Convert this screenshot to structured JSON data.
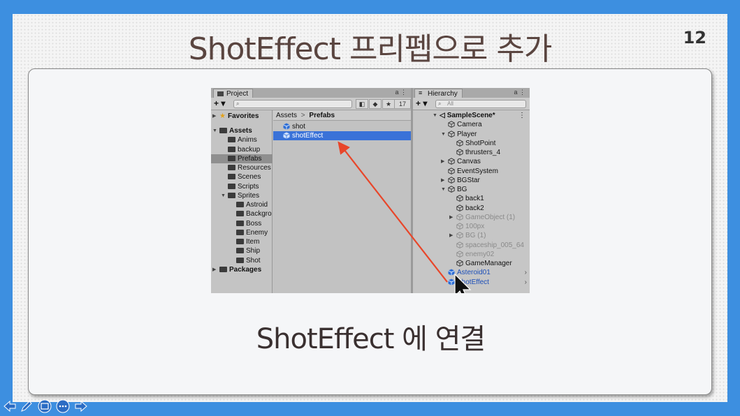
{
  "slide": {
    "title": "ShotEffect 프리펩으로 추가",
    "page_number": "12",
    "caption": "ShotEffect 에 연결"
  },
  "project_panel": {
    "tab_label": "Project",
    "tab_controls": "a ⋮",
    "add_button": "+ ▾",
    "search_placeholder": "",
    "hidden_count": "17",
    "tree": [
      {
        "label": "Favorites",
        "level": 0,
        "bold": true,
        "expanded": false,
        "icon": "star-icon"
      },
      {
        "label": "Assets",
        "level": 0,
        "bold": true,
        "expanded": true,
        "icon": "folder-open-icon"
      },
      {
        "label": "Anims",
        "level": 1
      },
      {
        "label": "backup",
        "level": 1
      },
      {
        "label": "Prefabs",
        "level": 1,
        "selected": true
      },
      {
        "label": "Resources",
        "level": 1
      },
      {
        "label": "Scenes",
        "level": 1
      },
      {
        "label": "Scripts",
        "level": 1
      },
      {
        "label": "Sprites",
        "level": 1,
        "expanded": true
      },
      {
        "label": "Astroid",
        "level": 2
      },
      {
        "label": "Backgro",
        "level": 2
      },
      {
        "label": "Boss",
        "level": 2
      },
      {
        "label": "Enemy",
        "level": 2
      },
      {
        "label": "Item",
        "level": 2
      },
      {
        "label": "Ship",
        "level": 2
      },
      {
        "label": "Shot",
        "level": 2
      },
      {
        "label": "Packages",
        "level": 0,
        "bold": true,
        "expanded": false
      }
    ],
    "breadcrumb": {
      "root": "Assets",
      "separator": ">",
      "current": "Prefabs"
    },
    "files": [
      {
        "label": "shot",
        "selected": false
      },
      {
        "label": "shotEffect",
        "selected": true
      }
    ]
  },
  "hierarchy_panel": {
    "tab_label": "Hierarchy",
    "tab_controls": "a ⋮",
    "add_button": "+ ▾",
    "search_placeholder": "All",
    "rows": [
      {
        "label": "SampleScene*",
        "level": 0,
        "bold": true,
        "expanded": true,
        "kind": "scene"
      },
      {
        "label": "Camera",
        "level": 1
      },
      {
        "label": "Player",
        "level": 1,
        "expanded": true
      },
      {
        "label": "ShotPoint",
        "level": 2
      },
      {
        "label": "thrusters_4",
        "level": 2
      },
      {
        "label": "Canvas",
        "level": 1,
        "collapsed": true
      },
      {
        "label": "EventSystem",
        "level": 1
      },
      {
        "label": "BGStar",
        "level": 1,
        "collapsed": true
      },
      {
        "label": "BG",
        "level": 1,
        "expanded": true
      },
      {
        "label": "back1",
        "level": 2
      },
      {
        "label": "back2",
        "level": 2
      },
      {
        "label": "GameObject (1)",
        "level": 2,
        "collapsed": true,
        "dim": true
      },
      {
        "label": "100px",
        "level": 2,
        "dim": true
      },
      {
        "label": "BG (1)",
        "level": 2,
        "collapsed": true,
        "dim": true
      },
      {
        "label": "spaceship_005_64",
        "level": 2,
        "dim": true
      },
      {
        "label": "enemy02",
        "level": 2,
        "dim": true
      },
      {
        "label": "GameManager",
        "level": 2
      },
      {
        "label": "Asteroid01",
        "level": 1,
        "prefab": true
      },
      {
        "label": "ShotEffect",
        "level": 1,
        "prefab": true
      }
    ]
  },
  "annotation": {
    "arrow_color": "#e8462a"
  },
  "colors": {
    "frame": "#3d8fe0",
    "selection": "#3a72d8",
    "title_text": "#5a4540"
  },
  "nav_icons": [
    "arrow-left-icon",
    "pen-icon",
    "slides-icon",
    "more-icon",
    "arrow-right-icon"
  ]
}
